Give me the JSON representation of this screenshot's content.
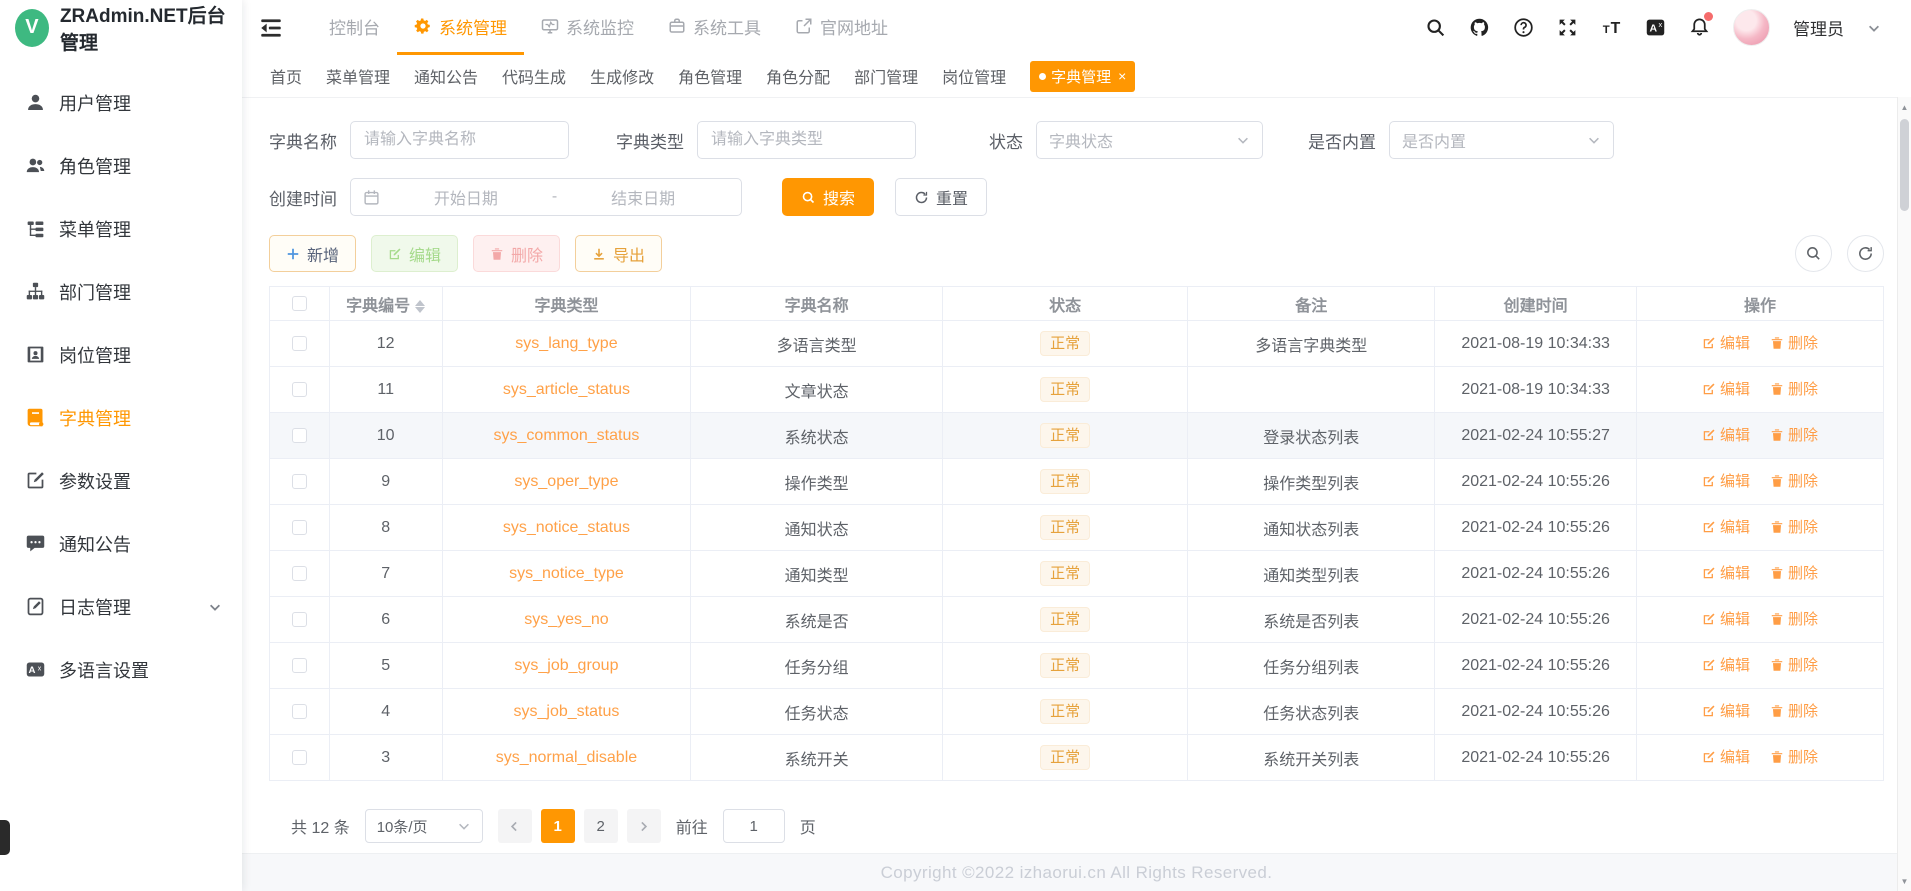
{
  "app": {
    "title": "ZRAdmin.NET后台管理",
    "logo_letter": "V"
  },
  "topnav": {
    "items": [
      {
        "label": "控制台",
        "active": false
      },
      {
        "label": "系统管理",
        "active": true
      },
      {
        "label": "系统监控",
        "active": false
      },
      {
        "label": "系统工具",
        "active": false
      },
      {
        "label": "官网地址",
        "active": false
      }
    ],
    "user_name": "管理员"
  },
  "sidebar": {
    "items": [
      {
        "label": "用户管理"
      },
      {
        "label": "角色管理"
      },
      {
        "label": "菜单管理"
      },
      {
        "label": "部门管理"
      },
      {
        "label": "岗位管理"
      },
      {
        "label": "字典管理",
        "active": true
      },
      {
        "label": "参数设置"
      },
      {
        "label": "通知公告"
      },
      {
        "label": "日志管理",
        "has_children": true
      },
      {
        "label": "多语言设置"
      }
    ]
  },
  "tabs": {
    "items": [
      {
        "label": "首页"
      },
      {
        "label": "菜单管理"
      },
      {
        "label": "通知公告"
      },
      {
        "label": "代码生成"
      },
      {
        "label": "生成修改"
      },
      {
        "label": "角色管理"
      },
      {
        "label": "角色分配"
      },
      {
        "label": "部门管理"
      },
      {
        "label": "岗位管理"
      },
      {
        "label": "字典管理",
        "active": true,
        "closable": true
      }
    ]
  },
  "search_form": {
    "fields": [
      {
        "label": "字典名称",
        "placeholder": "请输入字典名称"
      },
      {
        "label": "字典类型",
        "placeholder": "请输入字典类型"
      },
      {
        "label": "状态",
        "placeholder": "字典状态"
      },
      {
        "label": "是否内置",
        "placeholder": "是否内置"
      }
    ],
    "date_field": {
      "label": "创建时间",
      "start_placeholder": "开始日期",
      "separator": "-",
      "end_placeholder": "结束日期"
    },
    "search_label": "搜索",
    "reset_label": "重置"
  },
  "toolbar": {
    "add_label": "新增",
    "edit_label": "编辑",
    "delete_label": "删除",
    "export_label": "导出"
  },
  "table": {
    "columns": [
      "",
      "字典编号",
      "字典类型",
      "字典名称",
      "状态",
      "备注",
      "创建时间",
      "操作"
    ],
    "edit_label": "编辑",
    "delete_label": "删除",
    "rows": [
      {
        "id": "12",
        "type": "sys_lang_type",
        "name": "多语言类型",
        "status": "正常",
        "remark": "多语言字典类型",
        "created": "2021-08-19 10:34:33",
        "highlight": false
      },
      {
        "id": "11",
        "type": "sys_article_status",
        "name": "文章状态",
        "status": "正常",
        "remark": "",
        "created": "2021-08-19 10:34:33",
        "highlight": false
      },
      {
        "id": "10",
        "type": "sys_common_status",
        "name": "系统状态",
        "status": "正常",
        "remark": "登录状态列表",
        "created": "2021-02-24 10:55:27",
        "highlight": true
      },
      {
        "id": "9",
        "type": "sys_oper_type",
        "name": "操作类型",
        "status": "正常",
        "remark": "操作类型列表",
        "created": "2021-02-24 10:55:26",
        "highlight": false
      },
      {
        "id": "8",
        "type": "sys_notice_status",
        "name": "通知状态",
        "status": "正常",
        "remark": "通知状态列表",
        "created": "2021-02-24 10:55:26",
        "highlight": false
      },
      {
        "id": "7",
        "type": "sys_notice_type",
        "name": "通知类型",
        "status": "正常",
        "remark": "通知类型列表",
        "created": "2021-02-24 10:55:26",
        "highlight": false
      },
      {
        "id": "6",
        "type": "sys_yes_no",
        "name": "系统是否",
        "status": "正常",
        "remark": "系统是否列表",
        "created": "2021-02-24 10:55:26",
        "highlight": false
      },
      {
        "id": "5",
        "type": "sys_job_group",
        "name": "任务分组",
        "status": "正常",
        "remark": "任务分组列表",
        "created": "2021-02-24 10:55:26",
        "highlight": false
      },
      {
        "id": "4",
        "type": "sys_job_status",
        "name": "任务状态",
        "status": "正常",
        "remark": "任务状态列表",
        "created": "2021-02-24 10:55:26",
        "highlight": false
      },
      {
        "id": "3",
        "type": "sys_normal_disable",
        "name": "系统开关",
        "status": "正常",
        "remark": "系统开关列表",
        "created": "2021-02-24 10:55:26",
        "highlight": false
      }
    ]
  },
  "pagination": {
    "total_text": "共 12 条",
    "page_size": "10条/页",
    "pages": [
      "1",
      "2"
    ],
    "active_page": "1",
    "goto_label": "前往",
    "goto_value": "1",
    "page_suffix": "页"
  },
  "footer": {
    "copyright": "Copyright ©2022 izhaorui.cn All Rights Reserved."
  },
  "colors": {
    "primary": "#ff9702",
    "link": "#ffa148",
    "tag_text": "#e6a23c",
    "logo": "#3eb981"
  }
}
